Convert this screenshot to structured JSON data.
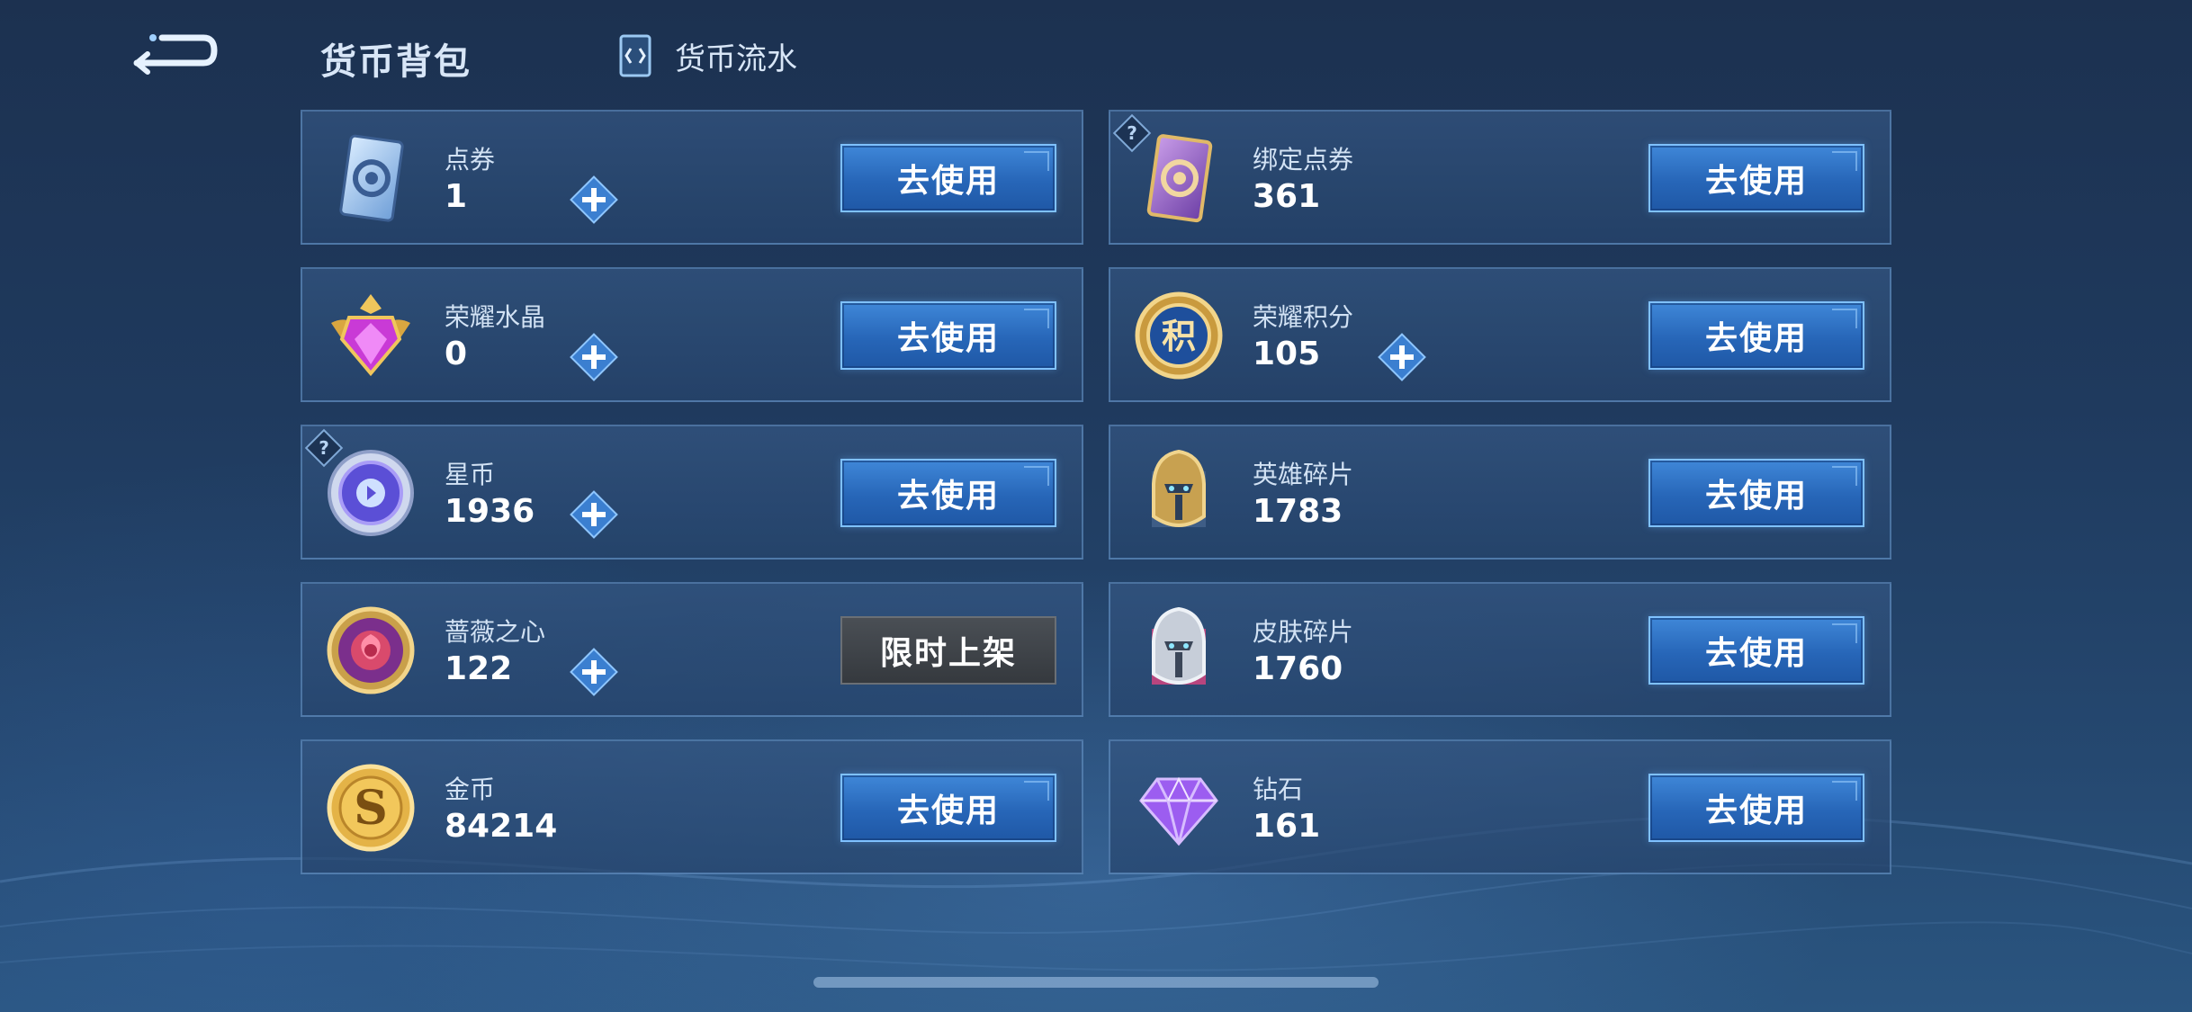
{
  "header": {
    "title": "货币背包",
    "flow_tab_label": "货币流水"
  },
  "use_label": "去使用",
  "currencies": [
    {
      "name": "点券",
      "amount": "1",
      "icon": "coupon-ticket-icon",
      "has_plus": true,
      "has_help": false,
      "action": "use"
    },
    {
      "name": "绑定点券",
      "amount": "361",
      "icon": "bound-coupon-ticket-icon",
      "has_plus": false,
      "has_help": true,
      "action": "use"
    },
    {
      "name": "荣耀水晶",
      "amount": "0",
      "icon": "glory-crystal-icon",
      "has_plus": true,
      "has_help": false,
      "action": "use"
    },
    {
      "name": "荣耀积分",
      "amount": "105",
      "icon": "glory-points-icon",
      "has_plus": true,
      "has_help": false,
      "action": "use"
    },
    {
      "name": "星币",
      "amount": "1936",
      "icon": "star-coin-icon",
      "has_plus": true,
      "has_help": true,
      "action": "use"
    },
    {
      "name": "英雄碎片",
      "amount": "1783",
      "icon": "hero-fragment-icon",
      "has_plus": false,
      "has_help": false,
      "action": "use"
    },
    {
      "name": "蔷薇之心",
      "amount": "122",
      "icon": "rose-heart-icon",
      "has_plus": true,
      "has_help": false,
      "action": "limited",
      "limited_label": "限时上架"
    },
    {
      "name": "皮肤碎片",
      "amount": "1760",
      "icon": "skin-fragment-icon",
      "has_plus": false,
      "has_help": false,
      "action": "use"
    },
    {
      "name": "金币",
      "amount": "84214",
      "icon": "gold-coin-icon",
      "has_plus": false,
      "has_help": false,
      "action": "use"
    },
    {
      "name": "钻石",
      "amount": "161",
      "icon": "diamond-icon",
      "has_plus": false,
      "has_help": false,
      "action": "use"
    }
  ],
  "colors": {
    "button_blue": "#2f74c8",
    "button_border": "#7fc1ff",
    "limited_gray": "#3d4247",
    "card_bg": "#2c4c78",
    "plus_blue": "#5aa8f0"
  }
}
